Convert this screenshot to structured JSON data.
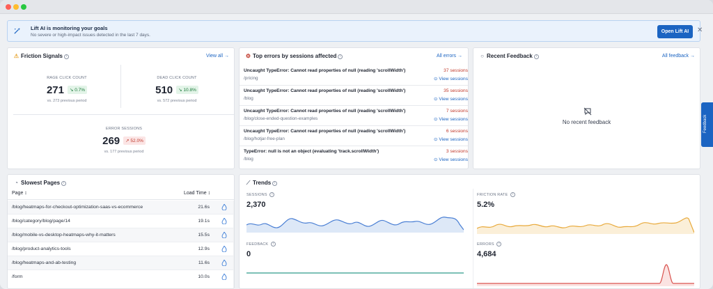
{
  "banner": {
    "title": "Lift AI is monitoring your goals",
    "subtitle": "No severe or high-impact issues detected in the last 7 days.",
    "button": "Open Lift AI",
    "close": "✕"
  },
  "friction": {
    "title": "Friction Signals",
    "link": "View all →",
    "metrics": [
      {
        "label": "RAGE CLICK COUNT",
        "value": "271",
        "change": "0.7%",
        "prev": "vs. 273 previous period",
        "trend": "down"
      },
      {
        "label": "DEAD CLICK COUNT",
        "value": "510",
        "change": "10.8%",
        "prev": "vs. 572 previous period",
        "trend": "down"
      },
      {
        "label": "ERROR SESSIONS",
        "value": "269",
        "change": "52.0%",
        "prev": "vs. 177 previous period",
        "trend": "up"
      }
    ]
  },
  "errors": {
    "title": "Top errors by sessions affected",
    "link": "All errors →",
    "view_label": "View sessions",
    "rows": [
      {
        "message": "Uncaught TypeError: Cannot read properties of null (reading 'scrollWidth')",
        "path": "/pricing",
        "count": "37 sessions"
      },
      {
        "message": "Uncaught TypeError: Cannot read properties of null (reading 'scrollWidth')",
        "path": "/blog",
        "count": "35 sessions"
      },
      {
        "message": "Uncaught TypeError: Cannot read properties of null (reading 'scrollWidth')",
        "path": "/blog/close-ended-question-examples",
        "count": "7 sessions"
      },
      {
        "message": "Uncaught TypeError: Cannot read properties of null (reading 'scrollWidth')",
        "path": "/blog/hotjar-free-plan",
        "count": "6 sessions"
      },
      {
        "message": "TypeError: null is not an object (evaluating 'track.scrollWidth')",
        "path": "/blog",
        "count": "3 sessions"
      }
    ]
  },
  "feedback": {
    "title": "Recent Feedback",
    "link": "All feedback →",
    "empty": "No recent feedback",
    "side_tab": "Feedback"
  },
  "slowest": {
    "title": "Slowest Pages",
    "col_page": "Page ↕",
    "col_time": "Load Time ↕",
    "rows": [
      {
        "url": "/blog/heatmaps-for-checkout-optimization-saas-vs-ecommerce",
        "time": "21.6s"
      },
      {
        "url": "/blog/category/blog/page/14",
        "time": "19.1s"
      },
      {
        "url": "/blog/mobile-vs-desktop-heatmaps-why-it-matters",
        "time": "15.5s"
      },
      {
        "url": "/blog/product-analytics-tools",
        "time": "12.9s"
      },
      {
        "url": "/blog/heatmaps-and-ab-testing",
        "time": "11.6s"
      },
      {
        "url": "/form",
        "time": "10.0s"
      }
    ]
  },
  "trends": {
    "title": "Trends",
    "metrics": [
      {
        "label": "SESSIONS",
        "value": "2,370",
        "color": "#4a7fd4"
      },
      {
        "label": "FRICTION RATE",
        "value": "5.2%",
        "color": "#e8a93a"
      },
      {
        "label": "FEEDBACK",
        "value": "0",
        "color": "#2e9a8a"
      },
      {
        "label": "ERRORS",
        "value": "4,684",
        "color": "#d9534f"
      }
    ]
  },
  "colors": {
    "primary": "#1b64c2",
    "danger": "#c0392b",
    "success": "#1d7a3c"
  }
}
